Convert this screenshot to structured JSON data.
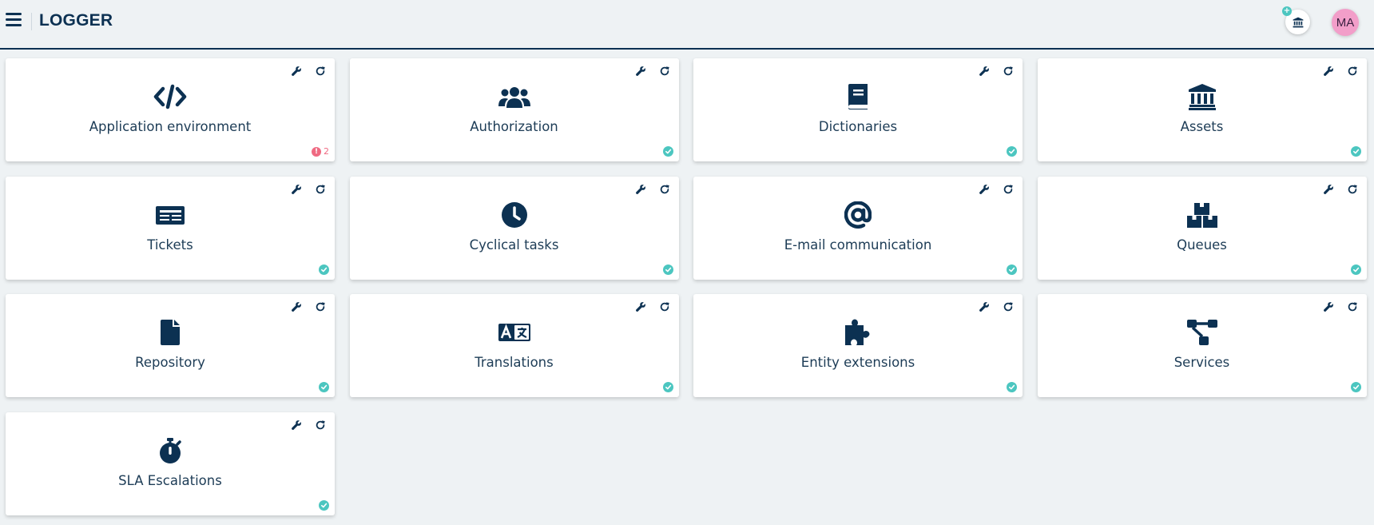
{
  "header": {
    "title": "LOGGER",
    "menu_icon": "hamburger-icon",
    "institution_icon": "bank-icon",
    "institution_badge": "+",
    "user_initials": "MA"
  },
  "colors": {
    "primary": "#0c3152",
    "ok": "#4cc6c0",
    "error": "#ef6a82",
    "avatar": "#f29ec9",
    "background": "#eef2f4"
  },
  "cards": [
    {
      "label": "Application environment",
      "icon": "code-icon",
      "status": "error",
      "status_count": "2"
    },
    {
      "label": "Authorization",
      "icon": "users-icon",
      "status": "ok"
    },
    {
      "label": "Dictionaries",
      "icon": "book-icon",
      "status": "ok"
    },
    {
      "label": "Assets",
      "icon": "bank-icon",
      "status": "ok"
    },
    {
      "label": "Tickets",
      "icon": "newspaper-icon",
      "status": "ok"
    },
    {
      "label": "Cyclical tasks",
      "icon": "clock-icon",
      "status": "ok"
    },
    {
      "label": "E-mail communication",
      "icon": "at-icon",
      "status": "ok"
    },
    {
      "label": "Queues",
      "icon": "boxes-icon",
      "status": "ok"
    },
    {
      "label": "Repository",
      "icon": "file-icon",
      "status": "ok"
    },
    {
      "label": "Translations",
      "icon": "language-icon",
      "status": "ok"
    },
    {
      "label": "Entity extensions",
      "icon": "puzzle-icon",
      "status": "ok"
    },
    {
      "label": "Services",
      "icon": "sitemap-icon",
      "status": "ok"
    },
    {
      "label": "SLA Escalations",
      "icon": "stopwatch-icon",
      "status": "ok"
    }
  ],
  "card_tools": {
    "settings_icon": "wrench-icon",
    "refresh_icon": "refresh-icon"
  }
}
